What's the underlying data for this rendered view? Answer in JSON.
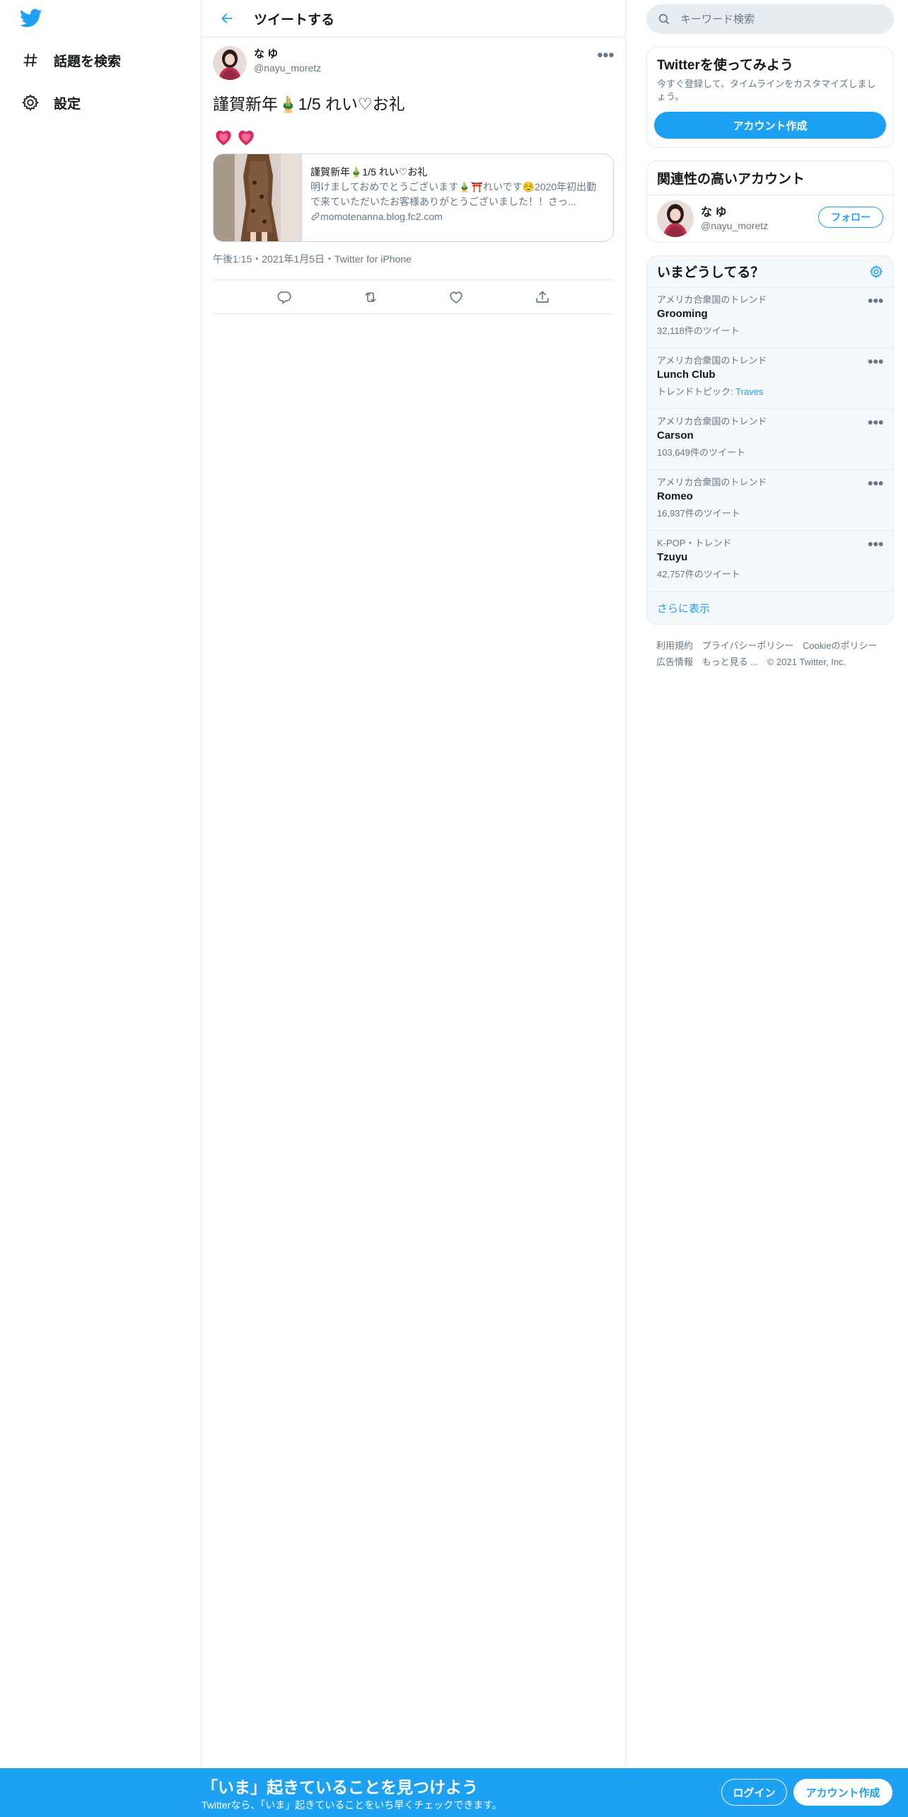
{
  "colors": {
    "accent": "#1da1f2",
    "text": "#14171a",
    "muted": "#657786",
    "border": "#e6ecf0"
  },
  "nav": {
    "logo_icon": "twitter-bird-icon",
    "items": [
      {
        "label": "話題を検索",
        "icon": "hashtag-icon"
      },
      {
        "label": "設定",
        "icon": "gear-icon"
      }
    ]
  },
  "header": {
    "title": "ツイートする",
    "back_icon": "back-arrow-icon"
  },
  "tweet": {
    "author_name": "な ゆ",
    "author_handle": "@nayu_moretz",
    "text": "謹賀新年🎍1/5 れい♡お礼",
    "hearts": [
      "💗",
      "💗"
    ],
    "card": {
      "title": "謹賀新年🎍1/5 れい♡お礼",
      "description": "明けましておめでとうございます🎍⛩️れいです☺️2020年初出勤で来ていただいたお客様ありがとうございました！！さっ...",
      "domain": "momotenanna.blog.fc2.com"
    },
    "meta": "午後1:15・2021年1月5日・Twitter for iPhone",
    "actions": [
      "reply-icon",
      "retweet-icon",
      "like-icon",
      "share-icon"
    ]
  },
  "search": {
    "placeholder": "キーワード検索"
  },
  "signup_box": {
    "title": "Twitterを使ってみよう",
    "subtitle": "今すぐ登録して、タイムラインをカスタマイズしましょう。",
    "button": "アカウント作成"
  },
  "related": {
    "title": "関連性の高いアカウント",
    "name": "な ゆ",
    "handle": "@nayu_moretz",
    "follow": "フォロー"
  },
  "trends": {
    "title": "いまどうしてる？",
    "items": [
      {
        "context": "アメリカ合衆国のトレンド",
        "name": "Grooming",
        "count": "32,118件のツイート"
      },
      {
        "context": "アメリカ合衆国のトレンド",
        "name": "Lunch Club",
        "count": "トレンドトピック: ",
        "link": "Traves"
      },
      {
        "context": "アメリカ合衆国のトレンド",
        "name": "Carson",
        "count": "103,649件のツイート"
      },
      {
        "context": "アメリカ合衆国のトレンド",
        "name": "Romeo",
        "count": "16,937件のツイート"
      },
      {
        "context": "K-POP・トレンド",
        "name": "Tzuyu",
        "count": "42,757件のツイート"
      }
    ],
    "show_more": "さらに表示"
  },
  "footer": {
    "links": [
      "利用規約",
      "プライバシーポリシー",
      "Cookieのポリシー",
      "広告情報",
      "もっと見る ..."
    ],
    "copyright": "© 2021 Twitter, Inc."
  },
  "bottom_bar": {
    "title": "「いま」起きていることを見つけよう",
    "subtitle": "Twitterなら、「いま」起きていることをいち早くチェックできます。",
    "login": "ログイン",
    "signup": "アカウント作成"
  }
}
